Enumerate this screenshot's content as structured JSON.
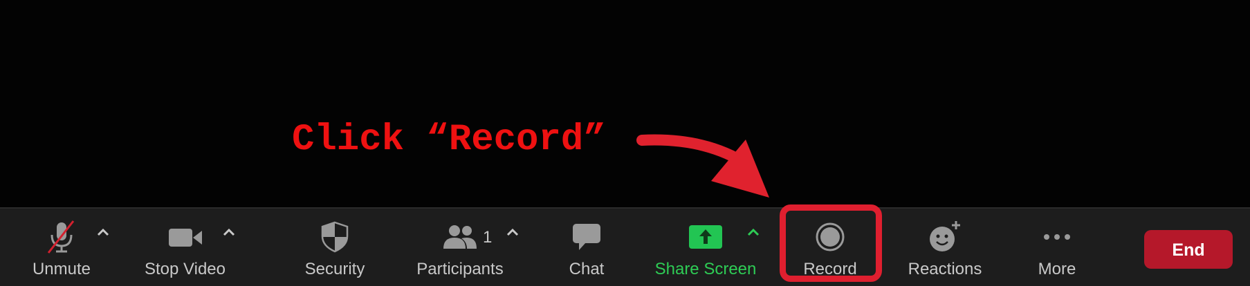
{
  "annotation": {
    "text": "Click “Record”",
    "color": "#ee1111"
  },
  "toolbar": {
    "unmute_label": "Unmute",
    "stop_video_label": "Stop Video",
    "security_label": "Security",
    "participants_label": "Participants",
    "participants_count": "1",
    "chat_label": "Chat",
    "share_screen_label": "Share Screen",
    "record_label": "Record",
    "reactions_label": "Reactions",
    "more_label": "More",
    "end_label": "End"
  },
  "colors": {
    "share_green": "#2ecc55",
    "end_red": "#b5182a",
    "highlight_red": "#df1f2f",
    "toolbar_bg": "#1d1d1d"
  },
  "icons": [
    "microphone-muted-icon",
    "video-camera-icon",
    "shield-icon",
    "participants-icon",
    "chat-bubble-icon",
    "share-screen-arrow-icon",
    "record-icon",
    "reactions-smiley-icon",
    "more-dots-icon",
    "chevron-up-icon"
  ]
}
